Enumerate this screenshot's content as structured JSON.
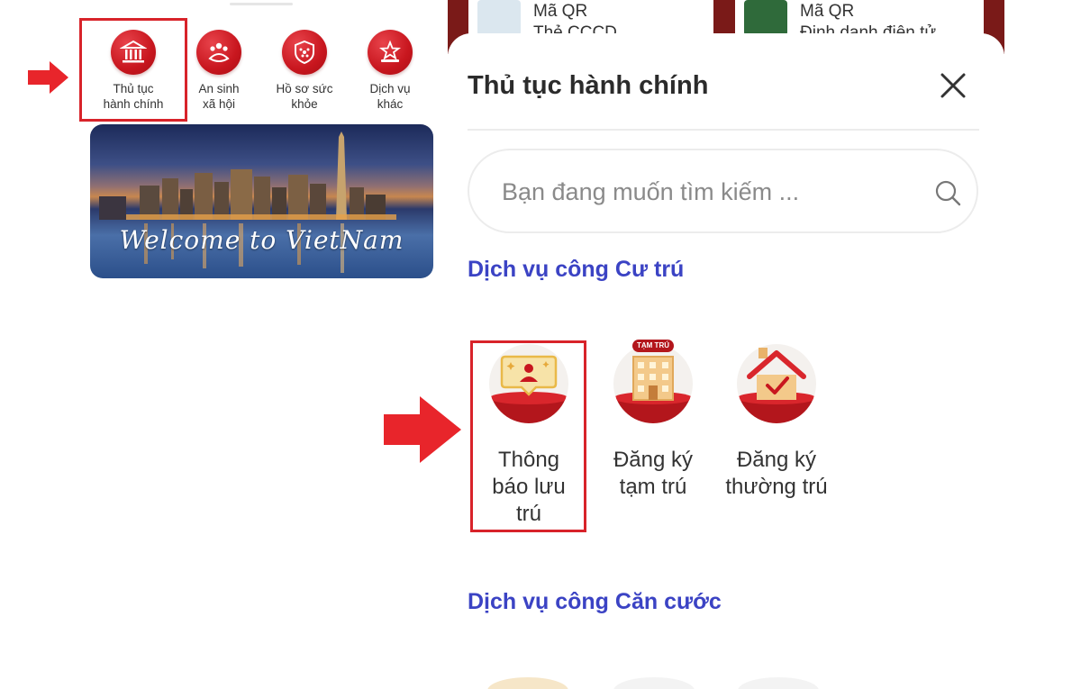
{
  "left_panel": {
    "services": [
      {
        "label_line1": "Thủ tục",
        "label_line2": "hành chính",
        "icon": "bank-icon"
      },
      {
        "label_line1": "An sinh",
        "label_line2": "xã hội",
        "icon": "people-icon"
      },
      {
        "label_line1": "Hồ sơ sức",
        "label_line2": "khỏe",
        "icon": "health-shield-icon"
      },
      {
        "label_line1": "Dịch vụ",
        "label_line2": "khác",
        "icon": "star-badge-icon"
      }
    ],
    "banner_text": "Welcome to VietNam"
  },
  "qr_cards": [
    {
      "line1": "Mã QR",
      "line2": "Thẻ CCCD"
    },
    {
      "line1": "Mã QR",
      "line2": "Định danh điện tử"
    }
  ],
  "sheet": {
    "title": "Thủ tục hành chính",
    "search_placeholder": "Bạn đang muốn tìm kiếm ...",
    "section1_title": "Dịch vụ công Cư trú",
    "tiles": [
      {
        "line1": "Thông",
        "line2": "báo lưu",
        "line3": "trú",
        "icon": "notification-person-icon"
      },
      {
        "line1": "Đăng ký",
        "line2": "tạm trú",
        "line3": "",
        "icon": "temporary-residence-building-icon",
        "badge": "TẠM TRÚ"
      },
      {
        "line1": "Đăng ký",
        "line2": "thường trú",
        "line3": "",
        "icon": "permanent-residence-house-icon"
      }
    ],
    "section2_title": "Dịch vụ công Căn cước"
  },
  "colors": {
    "brand_red": "#c8161e",
    "section_blue": "#3b43c4",
    "highlight_red": "#d8232a"
  }
}
